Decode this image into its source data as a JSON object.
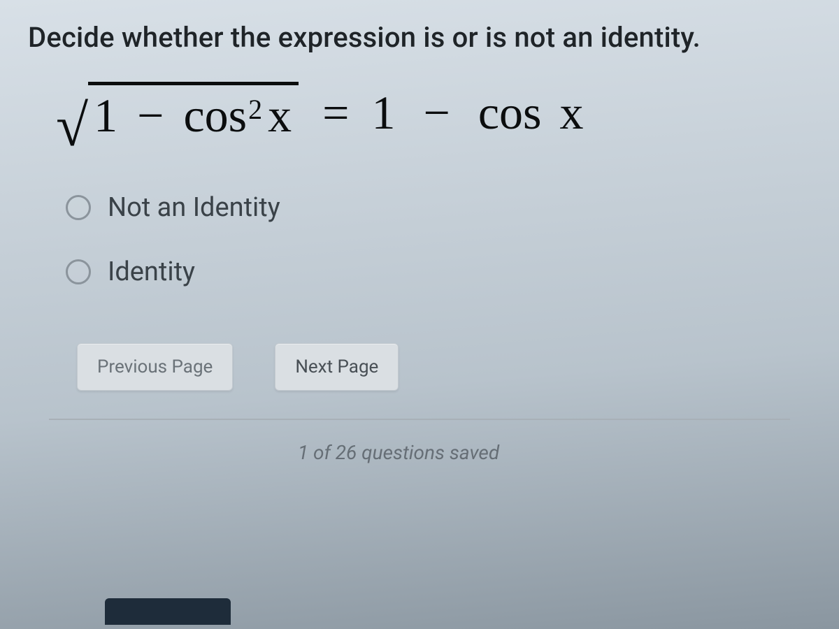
{
  "question": {
    "prompt": "Decide whether the expression is or is not an identity.",
    "expression": {
      "sqrt_part_1": "1",
      "sqrt_minus": "−",
      "sqrt_cos": "cos",
      "sqrt_exp": "2",
      "sqrt_x": "x",
      "equals": "=",
      "rhs_1": "1",
      "rhs_minus": "−",
      "rhs_cos": "cos",
      "rhs_x": "x"
    }
  },
  "options": [
    {
      "label": "Not an Identity"
    },
    {
      "label": "Identity"
    }
  ],
  "nav": {
    "previous": "Previous Page",
    "next": "Next Page"
  },
  "status": "1 of 26 questions saved"
}
